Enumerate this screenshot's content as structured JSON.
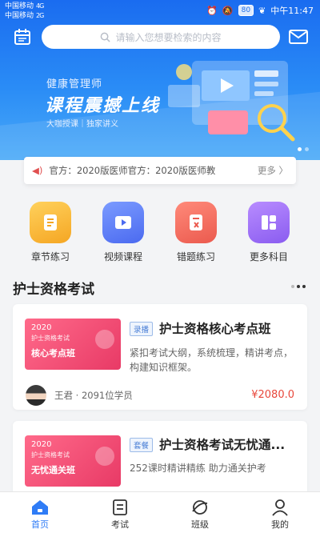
{
  "status_bar": {
    "carrier_1": "中国移动",
    "carrier_2": "中国移动",
    "signal_1": "4G",
    "signal_2": "2G",
    "battery": "80",
    "time": "中午11:47"
  },
  "search": {
    "placeholder": "请输入您想要检索的内容"
  },
  "banner": {
    "subtitle": "健康管理师",
    "title": "课程震撼上线",
    "tagline": "大咖授课｜独家讲义"
  },
  "notice": {
    "text": "官方：2020版医师官方：2020版医师教",
    "more": "更多 〉"
  },
  "quick_entries": [
    {
      "label": "章节练习",
      "color": "#f7b731",
      "icon": "notes-icon"
    },
    {
      "label": "视频课程",
      "color": "#5b7cf2",
      "icon": "video-icon"
    },
    {
      "label": "错题练习",
      "color": "#f0675d",
      "icon": "error-notes-icon"
    },
    {
      "label": "更多科目",
      "color": "#9b6cf2",
      "icon": "more-subjects-icon"
    }
  ],
  "section": {
    "title": "护士资格考试"
  },
  "courses": [
    {
      "thumb_year": "2020",
      "thumb_small": "护士资格考试",
      "thumb_big": "核心考点班",
      "tag": "录播",
      "title": "护士资格核心考点班",
      "desc": "紧扣考试大纲，系统梳理，精讲考点，构建知识框架。",
      "teacher": "王君 · 2091位学员",
      "price": "¥2080.0"
    },
    {
      "thumb_year": "2020",
      "thumb_small": "护士资格考试",
      "thumb_big": "无忧通关班",
      "tag": "套餐",
      "title": "护士资格考试无忧通...",
      "desc": "252课时精讲精练  助力通关护考"
    }
  ],
  "tabbar": {
    "items": [
      {
        "label": "首页",
        "icon": "home-icon",
        "active": true
      },
      {
        "label": "考试",
        "icon": "exam-icon",
        "active": false
      },
      {
        "label": "班级",
        "icon": "class-icon",
        "active": false
      },
      {
        "label": "我的",
        "icon": "profile-icon",
        "active": false
      }
    ]
  },
  "colors": {
    "primary": "#2f7cf6",
    "price": "#e8473b",
    "accent_red": "#e05050"
  }
}
